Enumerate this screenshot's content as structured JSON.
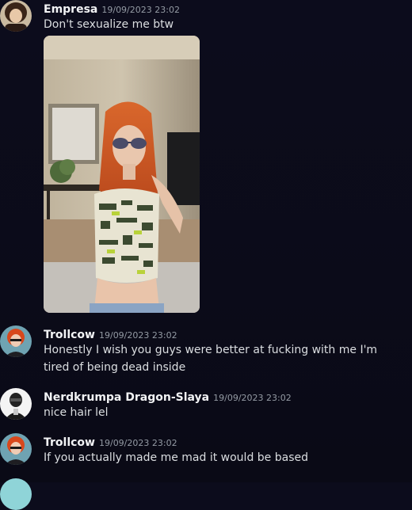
{
  "messages": [
    {
      "username": "Empresa",
      "timestamp": "19/09/2023 23:02",
      "text": "Don't sexualize me btw"
    },
    {
      "username": "Trollcow",
      "timestamp": "19/09/2023 23:02",
      "text": "Honestly I wish you guys were better at fucking with me I'm tired of being dead inside"
    },
    {
      "username": "Nerdkrumpa Dragon-Slaya",
      "timestamp": "19/09/2023 23:02",
      "text": "nice hair lel"
    },
    {
      "username": "Trollcow",
      "timestamp": "19/09/2023 23:02",
      "text": "If you actually made me mad it would be based"
    }
  ],
  "colors": {
    "background": "#0c0c1c",
    "username": "#f2f3f5",
    "message_text": "#dbdee1",
    "timestamp": "#949ba4"
  }
}
